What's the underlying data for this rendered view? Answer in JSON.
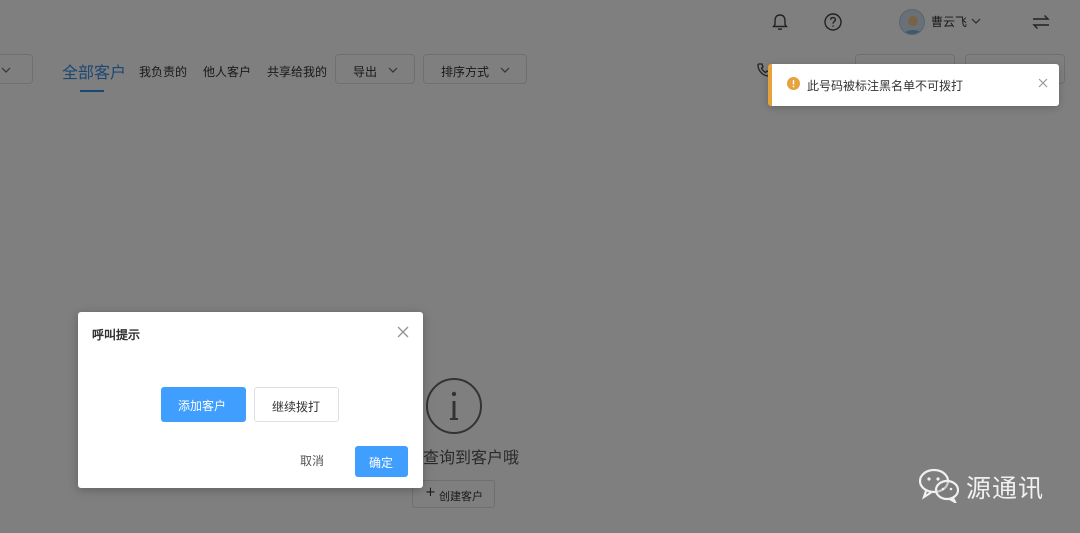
{
  "header": {
    "username": "曹云飞",
    "icons": [
      "bell-icon",
      "help-icon",
      "avatar",
      "chevron-down-icon",
      "swap-icon"
    ]
  },
  "toolbar": {
    "tabs": [
      {
        "label": "全部客户",
        "active": true
      },
      {
        "label": "我负责的"
      },
      {
        "label": "他人客户"
      },
      {
        "label": "共享给我的"
      }
    ],
    "export_label": "导出",
    "sort_label": "排序方式"
  },
  "empty_state": {
    "message": "查询到客户哦",
    "create_label": "创建客户"
  },
  "dialog": {
    "title": "呼叫提示",
    "add_customer_label": "添加客户",
    "continue_label": "继续拨打",
    "cancel_label": "取消",
    "confirm_label": "确定"
  },
  "notification": {
    "type": "warning",
    "message": "此号码被标注黑名单不可拨打"
  },
  "watermark": {
    "text": "源通讯"
  },
  "colors": {
    "primary": "#409eff",
    "warning": "#e6a23c",
    "mask": "rgba(0,0,0,0.5)"
  }
}
